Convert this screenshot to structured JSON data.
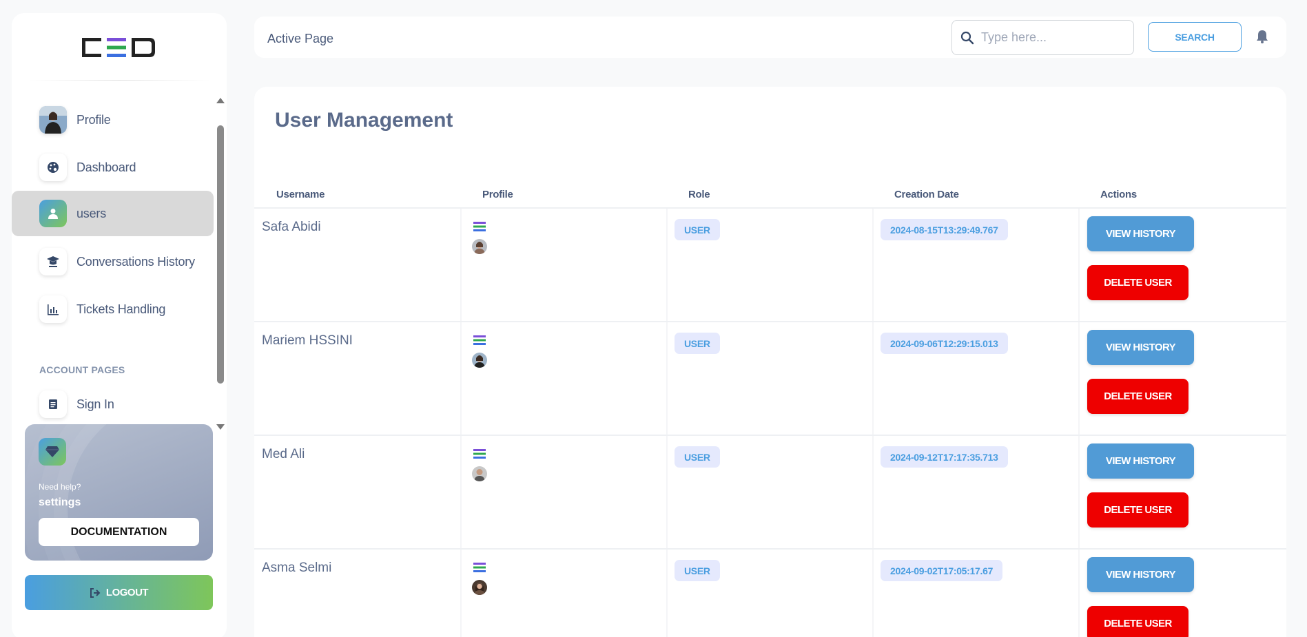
{
  "sidebar": {
    "items": [
      {
        "label": "Profile",
        "icon": "profile-avatar-icon"
      },
      {
        "label": "Dashboard",
        "icon": "palette-icon"
      },
      {
        "label": "users",
        "icon": "user-icon"
      },
      {
        "label": "Conversations History",
        "icon": "graduation-cap-icon"
      },
      {
        "label": "Tickets Handling",
        "icon": "bar-chart-icon"
      }
    ],
    "section_title": "ACCOUNT PAGES",
    "account_items": [
      {
        "label": "Sign In",
        "icon": "document-icon"
      }
    ],
    "help": {
      "small": "Need help?",
      "big": "settings",
      "button": "DOCUMENTATION"
    },
    "logout": "LOGOUT"
  },
  "topbar": {
    "breadcrumb": "Active Page",
    "search_placeholder": "Type here...",
    "search_button": "SEARCH"
  },
  "main": {
    "title": "User Management",
    "columns": [
      "Username",
      "Profile",
      "Role",
      "Creation Date",
      "Actions"
    ],
    "rows": [
      {
        "username": "Safa Abidi",
        "role": "USER",
        "date": "2024-08-15T13:29:49.767",
        "view": "VIEW HISTORY",
        "delete": "DELETE USER"
      },
      {
        "username": "Mariem HSSINI",
        "role": "USER",
        "date": "2024-09-06T12:29:15.013",
        "view": "VIEW HISTORY",
        "delete": "DELETE USER"
      },
      {
        "username": "Med Ali",
        "role": "USER",
        "date": "2024-09-12T17:17:35.713",
        "view": "VIEW HISTORY",
        "delete": "DELETE USER"
      },
      {
        "username": "Asma Selmi",
        "role": "USER",
        "date": "2024-09-02T17:05:17.67",
        "view": "VIEW HISTORY",
        "delete": "DELETE USER"
      }
    ]
  },
  "colors": {
    "accent_blue": "#4a9ee0",
    "accent_green": "#7ec65a",
    "danger": "#ee0000",
    "badge_bg": "#e5e9fd"
  }
}
